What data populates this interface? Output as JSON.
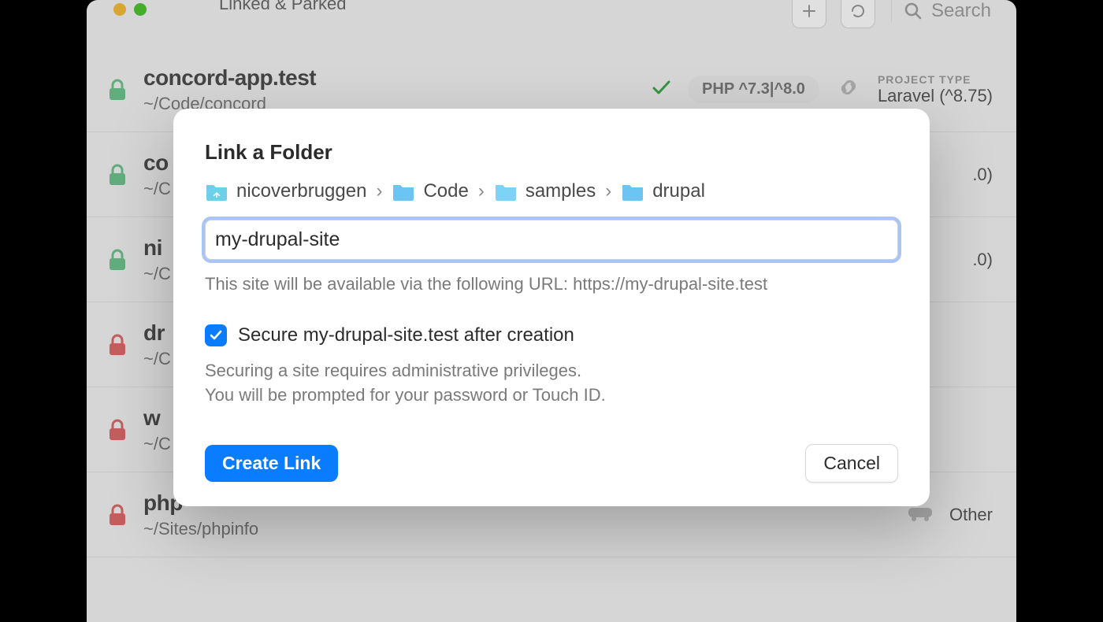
{
  "window": {
    "title": "Linked & Parked",
    "search_placeholder": "Search"
  },
  "sites": [
    {
      "name": "concord-app.test",
      "path": "~/Code/concord",
      "lock": "green",
      "checked": true,
      "php": "PHP ^7.3|^8.0",
      "project_label": "PROJECT TYPE",
      "project_value": "Laravel (^8.75)"
    },
    {
      "name": "co",
      "path": "~/C",
      "lock": "green",
      "project_suffix": ".0)"
    },
    {
      "name": "ni",
      "path": "~/C",
      "lock": "green",
      "project_suffix": ".0)"
    },
    {
      "name": "dr",
      "path": "~/C",
      "lock": "red"
    },
    {
      "name": "w",
      "path": "~/C",
      "lock": "red"
    },
    {
      "name": "php",
      "path": "~/Sites/phpinfo",
      "lock": "red",
      "project_value": "Other"
    }
  ],
  "modal": {
    "title": "Link a Folder",
    "breadcrumbs": [
      "nicoverbruggen",
      "Code",
      "samples",
      "drupal"
    ],
    "input_value": "my-drupal-site",
    "hint": "This site will be available via the following URL: https://my-drupal-site.test",
    "secure_label": "Secure my-drupal-site.test after creation",
    "secure_checked": true,
    "secure_sub1": "Securing a site requires administrative privileges.",
    "secure_sub2": "You will be prompted for your password or Touch ID.",
    "primary": "Create Link",
    "cancel": "Cancel"
  },
  "colors": {
    "lock_green": "#70c58f",
    "lock_red": "#e06c6c",
    "folder_home": "#6bd1e8",
    "folder": "#6cc4f2"
  }
}
